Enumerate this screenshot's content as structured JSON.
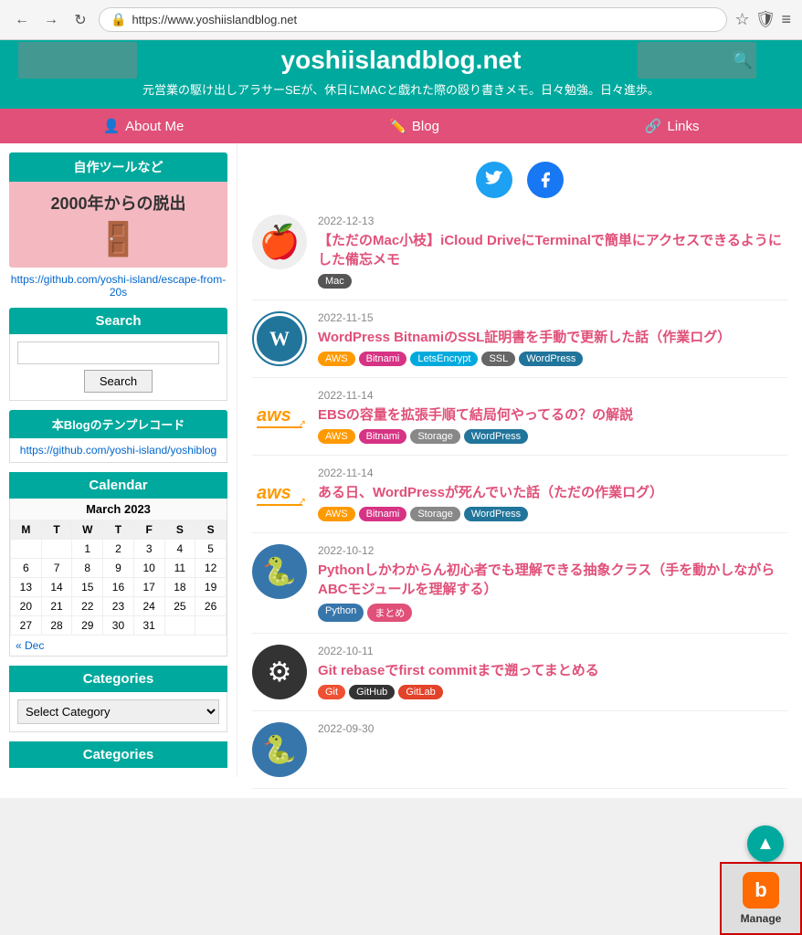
{
  "browser": {
    "url": "https://www.yoshiislandblog.net",
    "back_label": "←",
    "forward_label": "→",
    "refresh_label": "↻"
  },
  "header": {
    "site_title": "yoshiislandblog.net",
    "tagline": "元営業の駆け出しアラサーSEが、休日にMACと戯れた際の殴り書きメモ。日々勉強。日々進歩。",
    "search_placeholder": ""
  },
  "nav": {
    "items": [
      {
        "label": "About Me",
        "icon": "👤"
      },
      {
        "label": "Blog",
        "icon": "✏️"
      },
      {
        "label": "Links",
        "icon": "🔗"
      }
    ]
  },
  "sidebar": {
    "tool_box_title": "自作ツールなど",
    "tool_escape_title": "2000年からの脱出",
    "tool_icon": "🚪",
    "tool_link": "https://github.com/yoshi-island/escape-from-20s",
    "search_title": "Search",
    "search_button": "Search",
    "template_title": "本Blogのテンプレコード",
    "template_link": "https://github.com/yoshi-island/yoshiblog",
    "calendar_title": "Calendar",
    "calendar_month": "March 2023",
    "calendar_days_header": [
      "M",
      "T",
      "W",
      "T",
      "F",
      "S",
      "S"
    ],
    "calendar_weeks": [
      [
        "",
        "",
        "1",
        "2",
        "3",
        "4",
        "5"
      ],
      [
        "6",
        "7",
        "8",
        "9",
        "10",
        "11",
        "12"
      ],
      [
        "13",
        "14",
        "15",
        "16",
        "17",
        "18",
        "19"
      ],
      [
        "20",
        "21",
        "22",
        "23",
        "24",
        "25",
        "26"
      ],
      [
        "27",
        "28",
        "29",
        "30",
        "31",
        "",
        ""
      ]
    ],
    "calendar_prev": "« Dec",
    "categories_title": "Categories",
    "categories_select_default": "Select Category",
    "categories_title2": "Categories"
  },
  "social": {
    "twitter_label": "Twitter",
    "facebook_label": "Facebook"
  },
  "posts": [
    {
      "date": "2022-12-13",
      "title": "【ただのMac小枝】iCloud DriveにTerminalで簡単にアクセスできるようにした備忘メモ",
      "thumbnail_type": "apple",
      "tags": [
        {
          "label": "Mac",
          "class": "mac"
        }
      ]
    },
    {
      "date": "2022-11-15",
      "title": "WordPress BitnamiのSSL証明書を手動で更新した話（作業ログ）",
      "thumbnail_type": "wordpress",
      "tags": [
        {
          "label": "AWS",
          "class": "aws"
        },
        {
          "label": "Bitnami",
          "class": "bitnami"
        },
        {
          "label": "LetsEncrypt",
          "class": "letsencrypt"
        },
        {
          "label": "SSL",
          "class": "ssl"
        },
        {
          "label": "WordPress",
          "class": "wordpress"
        }
      ]
    },
    {
      "date": "2022-11-14",
      "title": "EBSの容量を拡張手順て結局何やってるの？の解説",
      "thumbnail_type": "aws",
      "tags": [
        {
          "label": "AWS",
          "class": "aws"
        },
        {
          "label": "Bitnami",
          "class": "bitnami"
        },
        {
          "label": "Storage",
          "class": "storage"
        },
        {
          "label": "WordPress",
          "class": "wordpress"
        }
      ]
    },
    {
      "date": "2022-11-14",
      "title": "ある日、WordPressが死んでいた話（ただの作業ログ）",
      "thumbnail_type": "aws",
      "tags": [
        {
          "label": "AWS",
          "class": "aws"
        },
        {
          "label": "Bitnami",
          "class": "bitnami"
        },
        {
          "label": "Storage",
          "class": "storage"
        },
        {
          "label": "WordPress",
          "class": "wordpress"
        }
      ]
    },
    {
      "date": "2022-10-12",
      "title": "Pythonしかわからん初心者でも理解できる抽象クラス（手を動かしながらABCモジュールを理解する）",
      "thumbnail_type": "python",
      "tags": [
        {
          "label": "Python",
          "class": "python"
        },
        {
          "label": "まとめ",
          "class": "matome"
        }
      ]
    },
    {
      "date": "2022-10-11",
      "title": "Git rebaseでfirst commitまで遡ってまとめる",
      "thumbnail_type": "github",
      "tags": [
        {
          "label": "Git",
          "class": "git"
        },
        {
          "label": "GitHub",
          "class": "github"
        },
        {
          "label": "GitLab",
          "class": "gitlab"
        }
      ]
    },
    {
      "date": "2022-09-30",
      "title": "",
      "thumbnail_type": "python",
      "tags": []
    }
  ],
  "scroll_top": "▲",
  "manage_label": "Manage"
}
